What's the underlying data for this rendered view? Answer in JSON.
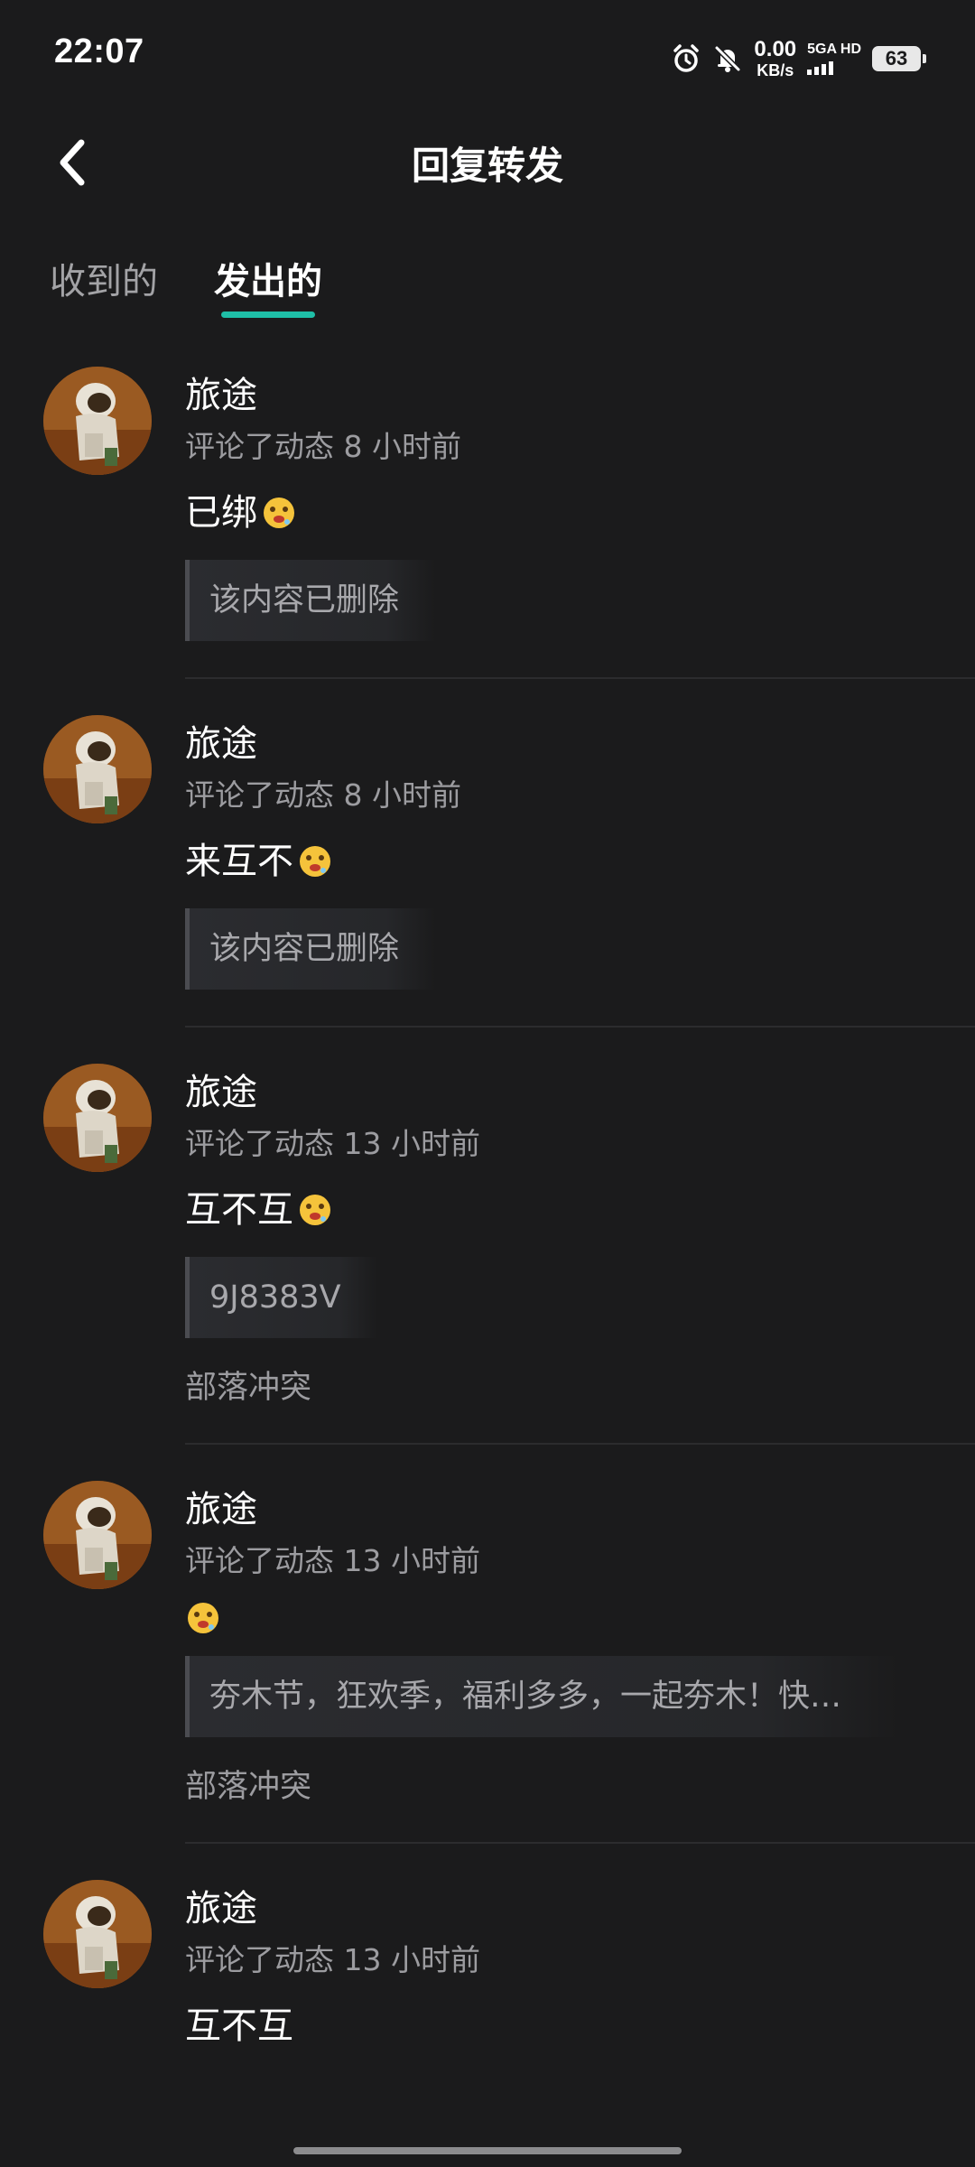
{
  "status_bar": {
    "time": "22:07",
    "net_speed_value": "0.00",
    "net_speed_unit": "KB/s",
    "network_label": "5GA HD",
    "battery_level": "63"
  },
  "header": {
    "title": "回复转发"
  },
  "tabs": [
    {
      "label": "收到的",
      "active": false
    },
    {
      "label": "发出的",
      "active": true
    }
  ],
  "feed": [
    {
      "user": "旅途",
      "meta": "评论了动态 8 小时前",
      "comment": "已绑",
      "has_emoji": true,
      "quote": "该内容已删除",
      "source": ""
    },
    {
      "user": "旅途",
      "meta": "评论了动态 8 小时前",
      "comment": "来互不",
      "has_emoji": true,
      "quote": "该内容已删除",
      "source": ""
    },
    {
      "user": "旅途",
      "meta": "评论了动态 13 小时前",
      "comment": "互不互",
      "has_emoji": true,
      "quote": "9J8383V",
      "source": "部落冲突"
    },
    {
      "user": "旅途",
      "meta": "评论了动态 13 小时前",
      "comment": "",
      "has_emoji": true,
      "quote": "夯木节，狂欢季，福利多多，一起夯木！快来…",
      "source": "部落冲突"
    },
    {
      "user": "旅途",
      "meta": "评论了动态 13 小时前",
      "comment": "互不互",
      "has_emoji": false,
      "quote": "",
      "source": ""
    }
  ],
  "colors": {
    "background": "#1b1b1c",
    "accent": "#1fbfa7",
    "secondary_text": "#9c9ca0"
  },
  "icons": {
    "back": "chevron-left-icon",
    "alarm": "alarm-icon",
    "mute": "bell-off-icon",
    "emoji": "drooling-face-emoji-icon"
  }
}
